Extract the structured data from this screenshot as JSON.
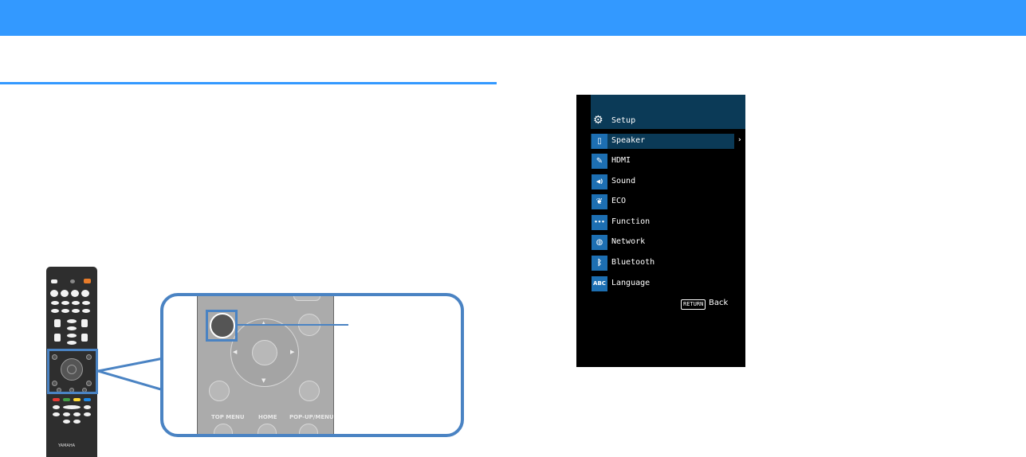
{
  "colors": {
    "accent": "#3399ff",
    "callout": "#4a83c3",
    "menu_header": "#0b3a57",
    "menu_icon": "#1d6fb2"
  },
  "zoom_panel": {
    "labels": {
      "top_menu": "TOP MENU",
      "home": "HOME",
      "popup_menu": "POP-UP/MENU"
    }
  },
  "remote": {
    "brand": "YAMAHA"
  },
  "tv_menu": {
    "title": "Setup",
    "title_icon": "gear-icon",
    "items": [
      {
        "label": "Speaker",
        "icon": "speaker-icon",
        "glyph": "▯"
      },
      {
        "label": "HDMI",
        "icon": "hdmi-icon",
        "glyph": "✎"
      },
      {
        "label": "Sound",
        "icon": "sound-icon",
        "glyph": "◀)"
      },
      {
        "label": "ECO",
        "icon": "eco-leaf-icon",
        "glyph": "❦"
      },
      {
        "label": "Function",
        "icon": "function-icon",
        "glyph": "•••"
      },
      {
        "label": "Network",
        "icon": "network-icon",
        "glyph": "◍"
      },
      {
        "label": "Bluetooth",
        "icon": "bluetooth-icon",
        "glyph": "ᛒ"
      },
      {
        "label": "Language",
        "icon": "language-icon",
        "glyph": "ABC"
      }
    ],
    "selected_index": 0,
    "return_key": "RETURN",
    "return_label": "Back"
  }
}
